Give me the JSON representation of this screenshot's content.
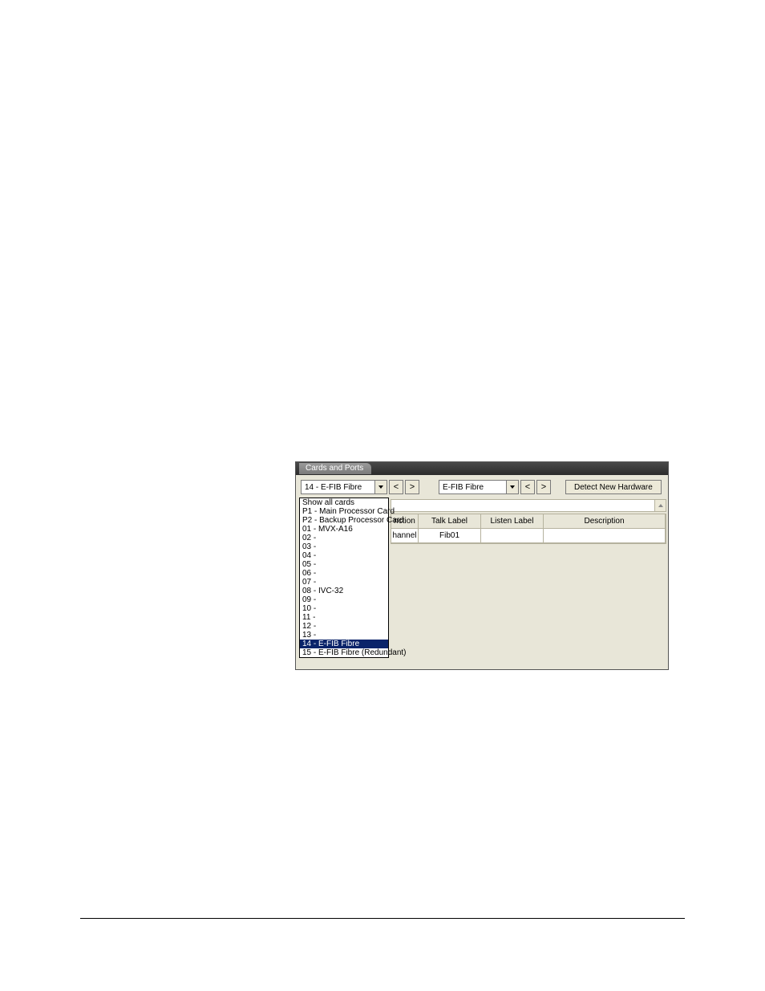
{
  "titlebar": {
    "tab": "Cards and Ports"
  },
  "toolbar": {
    "card_combo": "14 - E-FIB Fibre",
    "type_combo": "E-FIB Fibre",
    "prev": "<",
    "next": ">",
    "detect": "Detect New Hardware"
  },
  "dropdown": {
    "items": [
      "Show all cards",
      "P1 - Main Processor Card",
      "P2 - Backup Processor Card",
      "01 - MVX-A16",
      "02 -",
      "03 -",
      "04 -",
      "05 -",
      "06 -",
      "07 -",
      "08 - IVC-32",
      "09 -",
      "10 -",
      "11 -",
      "12 -",
      "13 -",
      "14 - E-FIB Fibre",
      "15 - E-FIB Fibre (Redundant)"
    ],
    "selected_index": 16
  },
  "table": {
    "headers": {
      "func": "nction",
      "talk": "Talk Label",
      "listen": "Listen Label",
      "desc": "Description"
    },
    "rows": [
      {
        "func": "hannel",
        "talk": "Fib01",
        "listen": "",
        "desc": ""
      }
    ]
  }
}
